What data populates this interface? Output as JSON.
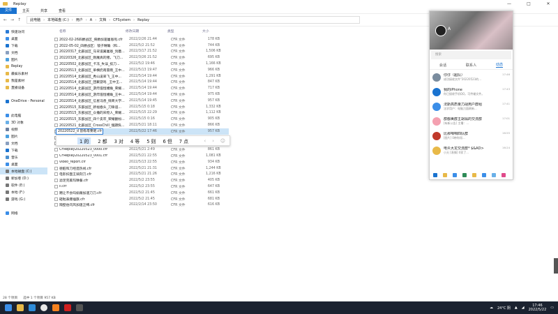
{
  "window_title": "Replay",
  "ribbon": [
    "文件",
    "主页",
    "共享",
    "查看"
  ],
  "breadcrumb": [
    "此电脑",
    "本地磁盘 (C:)",
    "用户",
    "A",
    "文档",
    "CFSystem",
    "Replay"
  ],
  "sidebar": [
    {
      "label": "快速访问",
      "color": "#2b7bd6"
    },
    {
      "label": "桌面",
      "color": "#3b8ee8"
    },
    {
      "label": "下载",
      "color": "#1a73d0"
    },
    {
      "label": "文档",
      "color": "#8aa0c0"
    },
    {
      "label": "图片",
      "color": "#4aa0e0"
    },
    {
      "label": "Replay",
      "color": "#e8b948"
    },
    {
      "label": "最娱乐素材",
      "color": "#e8b948"
    },
    {
      "label": "我是素材",
      "color": "#e8b948"
    },
    {
      "label": "直播设备",
      "color": "#e8b948"
    },
    {
      "label": "",
      "color": "transparent"
    },
    {
      "label": "OneDrive - Personal",
      "color": "#1a73d0"
    },
    {
      "label": "",
      "color": "transparent"
    },
    {
      "label": "此电脑",
      "color": "#3b8ee8"
    },
    {
      "label": "3D 对象",
      "color": "#6ab0e8"
    },
    {
      "label": "视频",
      "color": "#6b7fa0"
    },
    {
      "label": "图片",
      "color": "#4aa0e0"
    },
    {
      "label": "文档",
      "color": "#8aa0c0"
    },
    {
      "label": "下载",
      "color": "#1a73d0"
    },
    {
      "label": "音乐",
      "color": "#4a90d0"
    },
    {
      "label": "桌面",
      "color": "#3b8ee8"
    },
    {
      "label": "本地磁盘 (C:)",
      "color": "#777"
    },
    {
      "label": "新加卷 (D:)",
      "color": "#777"
    },
    {
      "label": "软件 (E:)",
      "color": "#777"
    },
    {
      "label": "本地 (F:)",
      "color": "#777"
    },
    {
      "label": "游戏 (G:)",
      "color": "#777"
    },
    {
      "label": "",
      "color": "transparent"
    },
    {
      "label": "网络",
      "color": "#3b8ee8"
    }
  ],
  "columns": {
    "name": "名称",
    "date": "修改日期",
    "type": "类型",
    "size": "大小"
  },
  "files": [
    {
      "name": "2022-02-26四爵战区_倚爵加速屠恩甩.cfr",
      "date": "2022/2/26 21:44",
      "type": "CFR 文件",
      "size": "178 KB"
    },
    {
      "name": "2022-05-02_四爵战区：镜子精确（和...",
      "date": "2022/5/2 21:52",
      "type": "CFR 文件",
      "size": "744 KB"
    },
    {
      "name": "20220317_北部战区_马背道翼屠恩_剑蘑...",
      "date": "2022/3/17 21:52",
      "type": "CFR 文件",
      "size": "1,506 KB"
    },
    {
      "name": "20220326_北部战区_刚魔真的猪，飞刀...",
      "date": "2022/3/26 21:52",
      "type": "CFR 文件",
      "size": "695 KB"
    },
    {
      "name": "20220502_北部战区_卡冻_失误_技刀...",
      "date": "2022/5/2 19:46",
      "type": "CFR 文件",
      "size": "1,166 KB"
    },
    {
      "name": "20220513_北部战区_单横扔南雷雨_王中...",
      "date": "2022/5/13 19:47",
      "type": "CFR 文件",
      "size": "966 KB"
    },
    {
      "name": "20220514_北部战区_秀山凌翠飞_王中...",
      "date": "2022/5/14 19:44",
      "type": "CFR 文件",
      "size": "1,291 KB"
    },
    {
      "name": "20220514_北部战区_团聚游戏 _王中王...",
      "date": "2022/5/14 19:44",
      "type": "CFR 文件",
      "size": "847 KB"
    },
    {
      "name": "20220514_北部战区_游炸值恒槽角_荣耀...",
      "date": "2022/5/14 19:44",
      "type": "CFR 文件",
      "size": "717 KB"
    },
    {
      "name": "20220514_北部战区_游炸值恒槽角_王中...",
      "date": "2022/5/14 19:44",
      "type": "CFR 文件",
      "size": "975 KB"
    },
    {
      "name": "20220514_北部战区_信星冯善_情商大学...",
      "date": "2022/5/14 19:45",
      "type": "CFR 文件",
      "size": "957 KB"
    },
    {
      "name": "20220515_东部战区_新福春头_刀锋道...",
      "date": "2022/5/15 0:18",
      "type": "CFR 文件",
      "size": "1,332 KB"
    },
    {
      "name": "20220515_东部战区_众撸的宋稳人_荣耀...",
      "date": "2022/5/15 22:29",
      "type": "CFR 文件",
      "size": "1,112 KB"
    },
    {
      "name": "20220515_东部战区_四个卖牢_荣耀翻纷...",
      "date": "2022/5/15 0:16",
      "type": "CFR 文件",
      "size": "905 KB"
    },
    {
      "name": "20220521_北部战区_CrossChill_傀期快...",
      "date": "2022/5/21 18:11",
      "type": "CFR 文件",
      "size": "866 KB"
    },
    {
      "name": "20220522_d 冒练母莱呢.cfr",
      "date": "2022/5/22 17:46",
      "type": "CFR 文件",
      "size": "957 KB"
    },
    {
      "name": "20220522_...",
      "date": "",
      "type": "CFR 文件",
      "size": ""
    },
    {
      "name": "CFReplay2...",
      "date": "",
      "type": "CFR 文件",
      "size": ""
    },
    {
      "name": "CFReplay20220523_0000.cfr",
      "date": "2022/5/21 2:49",
      "type": "CFR 文件",
      "size": "861 KB"
    },
    {
      "name": "CFReplay20220523_0001.cfr",
      "date": "2022/5/21 22:55",
      "type": "CFR 文件",
      "size": "1,081 KB"
    },
    {
      "name": "video_report.cfr",
      "date": "2022/5/13 22:55",
      "type": "CFR 文件",
      "size": "934 KB"
    },
    {
      "name": "德脏和刀经造热线.cfr",
      "date": "2022/5/21 21:31",
      "type": "CFR 文件",
      "size": "1,244 KB"
    },
    {
      "name": "电影扣面王骑刻刀.cfr",
      "date": "2022/5/21 21:26",
      "type": "CFR 文件",
      "size": "1,216 KB"
    },
    {
      "name": "滤足完美玛琳餐.cfr",
      "date": "2022/5/2 23:55",
      "type": "CFR 文件",
      "size": "405 KB"
    },
    {
      "name": "ll.cfr",
      "date": "2022/5/2 23:55",
      "type": "CFR 文件",
      "size": "647 KB"
    },
    {
      "name": "赌让不会吗偷跟加速刀刀.cfr",
      "date": "2022/5/2 21:45",
      "type": "CFR 文件",
      "size": "661 KB"
    },
    {
      "name": "砸啦表爆插旗.cfr",
      "date": "2022/5/2 21:45",
      "type": "CFR 文件",
      "size": "681 KB"
    },
    {
      "name": "隔壁伯问风加速正缚.cfr",
      "date": "2022/2/14 23:50",
      "type": "CFR 文件",
      "size": "616 KB"
    }
  ],
  "rename_value": "20220522_d 冒练母莱呢.cfr",
  "ime": [
    "1 的",
    "2 都",
    "3 对",
    "4 等",
    "5 则",
    "6 但",
    "7 点"
  ],
  "status": {
    "count": "28 个项目",
    "selected": "选中 1 个项目  957 KB"
  },
  "tray": {
    "weather": "24°C 阴",
    "time": "17:46",
    "date": "2022/5/22"
  },
  "qq": {
    "name": "A",
    "search": "搜索",
    "tabs": [
      "会话",
      "联系人",
      "动态"
    ],
    "messages": [
      {
        "name": "仔仔（超队）",
        "preview": "成功接收文件\"20220523的...",
        "time": "17:46",
        "color": "#7a8c9e"
      },
      {
        "name": "我的iPhone",
        "preview": "你已接收手机QQ，可传输文件。",
        "time": "17:43",
        "color": "#1a73d0"
      },
      {
        "name": "法斯高质量刀战用户群组",
        "preview": "法学用户：电脑刀面刷新...",
        "time": "17:41",
        "color": "#3b8ee8"
      },
      {
        "name": "群都美群主胡翁的交流群",
        "preview": "[有新公告] 主播：...",
        "time": "17:01",
        "color": "#f4a0b0"
      },
      {
        "name": "比那咱咱四队群",
        "preview": "[图片] 0带你闯...",
        "time": "16:55",
        "color": "#c0392b"
      },
      {
        "name": "电炎大龙交流群* $&AD>",
        "preview": "小天 [表情] 0家了...",
        "time": "16:24",
        "color": "#e8b948"
      }
    ]
  }
}
